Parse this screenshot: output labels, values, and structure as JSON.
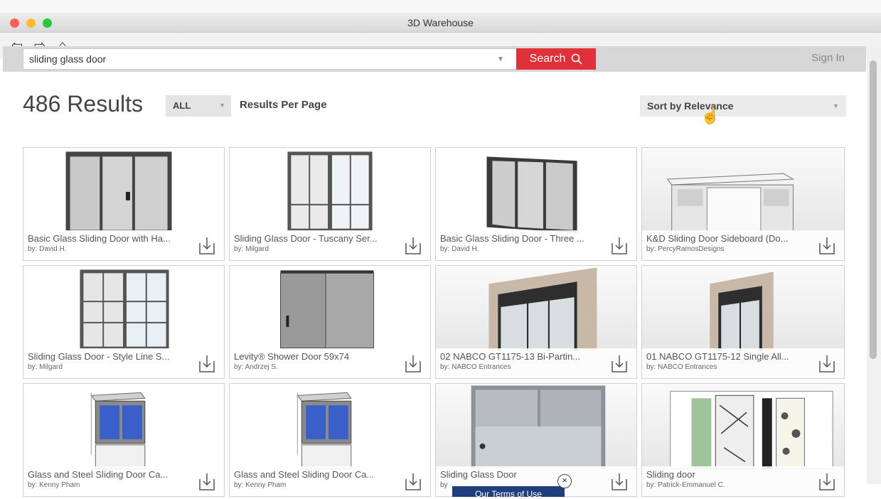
{
  "window": {
    "title": "3D Warehouse",
    "colors": {
      "close": "#fe5f57",
      "minimize": "#febc2e",
      "zoom": "#28c840",
      "accent": "#e0313a"
    }
  },
  "nav": {
    "back": "⇦",
    "forward": "⇨",
    "home": "⌂"
  },
  "search": {
    "query": "sliding glass door",
    "button_label": "Search",
    "sign_in": "Sign In"
  },
  "results": {
    "count_label": "486 Results",
    "filter": "ALL",
    "per_page_label": "Results Per Page",
    "sort": "Sort by Relevance"
  },
  "cards": [
    {
      "title": "Basic Glass Sliding Door with Ha...",
      "author": "by: David H.",
      "thumb": "glass-door-2panel"
    },
    {
      "title": "Sliding Glass Door - Tuscany Ser...",
      "author": "by: Milgard",
      "thumb": "gridded-door"
    },
    {
      "title": "Basic Glass Sliding Door - Three ...",
      "author": "by: David H.",
      "thumb": "glass-door-3panel"
    },
    {
      "title": "K&D Sliding Door Sideboard (Do...",
      "author": "by: PercyRamosDesigns",
      "thumb": "sideboard"
    },
    {
      "title": "Sliding Glass Door - Style Line S...",
      "author": "by: Milgard",
      "thumb": "gridded-door-2"
    },
    {
      "title": "Levity® Shower Door 59x74",
      "author": "by: Andrzej S.",
      "thumb": "shower-door"
    },
    {
      "title": "02 NABCO GT1175-13 Bi-Partin...",
      "author": "by: NABCO Entrances",
      "thumb": "nabco-door"
    },
    {
      "title": "01 NABCO GT1175-12 Single All...",
      "author": "by: NABCO Entrances",
      "thumb": "nabco-door-single"
    },
    {
      "title": "Glass and Steel Sliding Door Ca...",
      "author": "by: Kenny Pham",
      "thumb": "cabinet"
    },
    {
      "title": "Glass and Steel Sliding Door Ca...",
      "author": "by: Kenny Pham",
      "thumb": "cabinet"
    },
    {
      "title": "Sliding Glass Door",
      "author": "by",
      "thumb": "wide-door"
    },
    {
      "title": "Sliding door",
      "author": "by: Patrick-Emmanuel C.",
      "thumb": "patterned-door"
    }
  ],
  "banner": {
    "text": "Our Terms of Use",
    "close": "×"
  }
}
